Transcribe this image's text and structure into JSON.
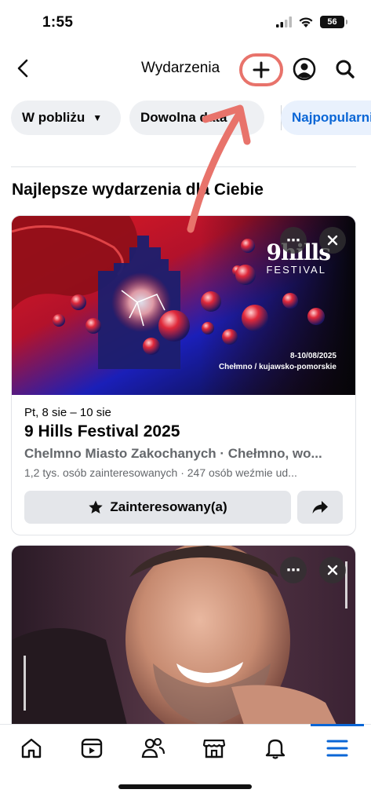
{
  "status_bar": {
    "time": "1:55",
    "battery": "56"
  },
  "header": {
    "title": "Wydarzenia"
  },
  "filters": [
    {
      "label": "W pobliżu"
    },
    {
      "label": "Dowolna data"
    },
    {
      "label": "Najpopularniejsze"
    }
  ],
  "section": {
    "title": "Najlepsze wydarzenia dla Ciebie"
  },
  "events": [
    {
      "image_logo_line1": "9hills",
      "image_logo_line2": "FESTIVAL",
      "image_dates": "8-10/08/2025",
      "image_place": "Chełmno / kujawsko-pomorskie",
      "date": "Pt, 8 sie – 10 sie",
      "title": "9 Hills Festival 2025",
      "location": "Chelmno  Miasto Zakochanych · Chełmno, wo...",
      "stats": "1,2 tys. osób zainteresowanych · 247 osób weźmie ud...",
      "interested_label": "Zainteresowany(a)"
    }
  ],
  "colors": {
    "accent": "#0a66d6",
    "annotation": "#e8736b",
    "chip_bg": "#eef0f3"
  }
}
